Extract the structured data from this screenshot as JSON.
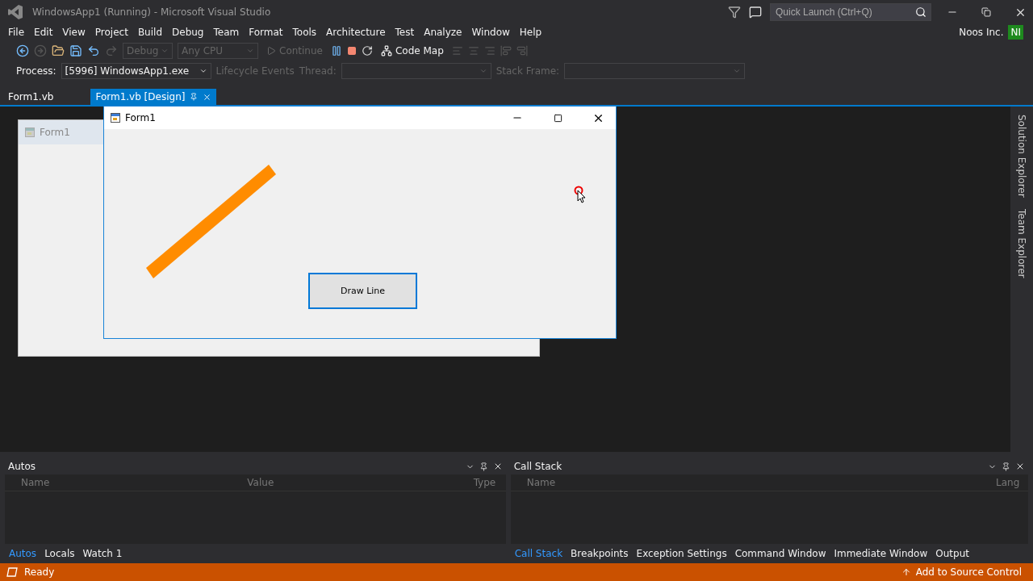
{
  "window": {
    "title": "WindowsApp1 (Running) - Microsoft Visual Studio"
  },
  "quick_launch": {
    "placeholder": "Quick Launch (Ctrl+Q)"
  },
  "menu": [
    "File",
    "Edit",
    "View",
    "Project",
    "Build",
    "Debug",
    "Team",
    "Format",
    "Tools",
    "Architecture",
    "Test",
    "Analyze",
    "Window",
    "Help"
  ],
  "account": {
    "name": "Noos Inc.",
    "initials": "NI"
  },
  "toolbar": [
    {
      "kind": "combo",
      "label": "Debug",
      "disabled": true
    },
    {
      "kind": "combo",
      "label": "Any CPU",
      "disabled": true
    },
    {
      "kind": "run",
      "label": "Continue",
      "disabled": true
    },
    {
      "kind": "map",
      "label": "Code Map",
      "disabled": false
    }
  ],
  "debug_location": {
    "process_label": "Process:",
    "process": "[5996] WindowsApp1.exe",
    "lifecycle": "Lifecycle Events",
    "thread_label": "Thread:",
    "stack_frame_label": "Stack Frame:"
  },
  "doc_tabs": [
    {
      "label": "Form1.vb",
      "selected": false
    },
    {
      "label": "Form1.vb [Design]",
      "selected": true
    }
  ],
  "designer_form": {
    "title": "Form1"
  },
  "running_form": {
    "title": "Form1",
    "button": "Draw Line"
  },
  "side_tabs": [
    "Solution Explorer",
    "Team Explorer"
  ],
  "panels": [
    {
      "title": "Autos",
      "columns": [
        "Name",
        "Value",
        "Type"
      ],
      "tabs": [
        {
          "label": "Autos",
          "selected": true
        },
        {
          "label": "Locals",
          "selected": false
        },
        {
          "label": "Watch 1",
          "selected": false
        }
      ]
    },
    {
      "title": "Call Stack",
      "columns": [
        "Name",
        "Lang"
      ],
      "tabs": [
        {
          "label": "Call Stack",
          "selected": true
        },
        {
          "label": "Breakpoints",
          "selected": false
        },
        {
          "label": "Exception Settings",
          "selected": false
        },
        {
          "label": "Command Window",
          "selected": false
        },
        {
          "label": "Immediate Window",
          "selected": false
        },
        {
          "label": "Output",
          "selected": false
        }
      ]
    }
  ],
  "status_bar": {
    "text": "Ready",
    "source_control": "Add to Source Control"
  }
}
